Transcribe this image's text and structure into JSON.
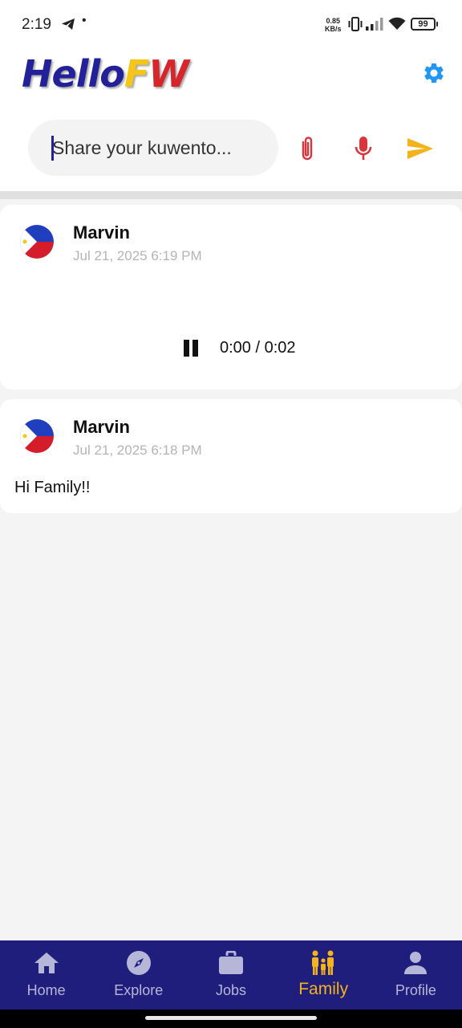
{
  "status_bar": {
    "time": "2:19",
    "dot": "•",
    "net_speed_value": "0.85",
    "net_speed_unit": "KB/s",
    "battery": "99"
  },
  "header": {
    "logo_part1": "Hello",
    "logo_part2": "F",
    "logo_part3": "W",
    "settings_icon": "gear-icon"
  },
  "composer": {
    "placeholder": "Share your kuwento...",
    "value": "",
    "attach_icon": "paperclip-icon",
    "mic_icon": "microphone-icon",
    "send_icon": "send-icon"
  },
  "posts": [
    {
      "author": "Marvin",
      "timestamp": "Jul 21, 2025 6:19 PM",
      "type": "audio",
      "audio_time": "0:00 / 0:02",
      "playing": true
    },
    {
      "author": "Marvin",
      "timestamp": "Jul 21, 2025 6:18 PM",
      "type": "text",
      "text": "Hi Family!!"
    }
  ],
  "bottom_nav": {
    "items": [
      {
        "label": "Home",
        "icon": "home-icon",
        "active": false
      },
      {
        "label": "Explore",
        "icon": "compass-icon",
        "active": false
      },
      {
        "label": "Jobs",
        "icon": "briefcase-icon",
        "active": false
      },
      {
        "label": "Family",
        "icon": "family-icon",
        "active": true
      },
      {
        "label": "Profile",
        "icon": "person-icon",
        "active": false
      }
    ]
  },
  "colors": {
    "brand_navy": "#1f1e7c",
    "brand_yellow": "#f5b31b",
    "brand_red": "#d7262b",
    "settings_blue": "#2196f3",
    "muted_text": "#b4b4b4"
  }
}
